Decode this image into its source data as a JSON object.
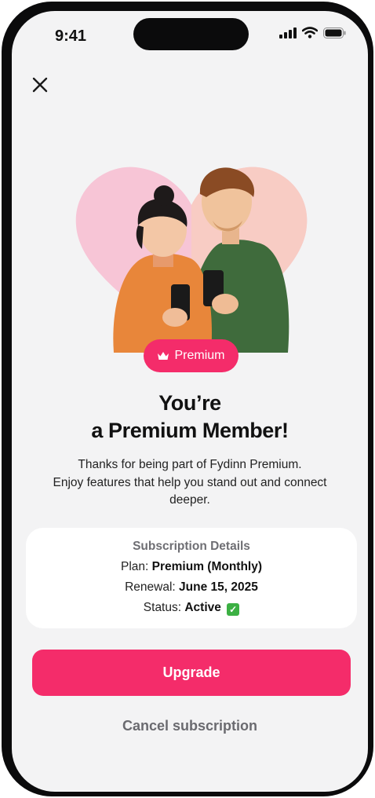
{
  "status_bar": {
    "time": "9:41",
    "icons": [
      "signal-icon",
      "wifi-icon",
      "battery-icon"
    ]
  },
  "header": {
    "close_icon": "close-icon"
  },
  "hero": {
    "image": "couple-with-phones-heart-illustration"
  },
  "badge": {
    "icon": "crown-icon",
    "label": "Premium"
  },
  "title": {
    "line1": "You’re",
    "line2": "a Premium Member!"
  },
  "description": {
    "line1": "Thanks for being part of Fydinn Premium.",
    "line2": "Enjoy features that help you stand out and connect",
    "line3": "deeper."
  },
  "subscription": {
    "heading": "Subscription Details",
    "plan_label": "Plan:",
    "plan_value": "Premium (Monthly)",
    "renewal_label": "Renewal:",
    "renewal_value": "June 15, 2025",
    "status_label": "Status:",
    "status_value": "Active"
  },
  "actions": {
    "upgrade_label": "Upgrade",
    "cancel_label": "Cancel subscription"
  },
  "colors": {
    "accent": "#f42c6a",
    "background": "#f3f3f4",
    "card": "#ffffff",
    "muted": "#6a6a6f"
  }
}
